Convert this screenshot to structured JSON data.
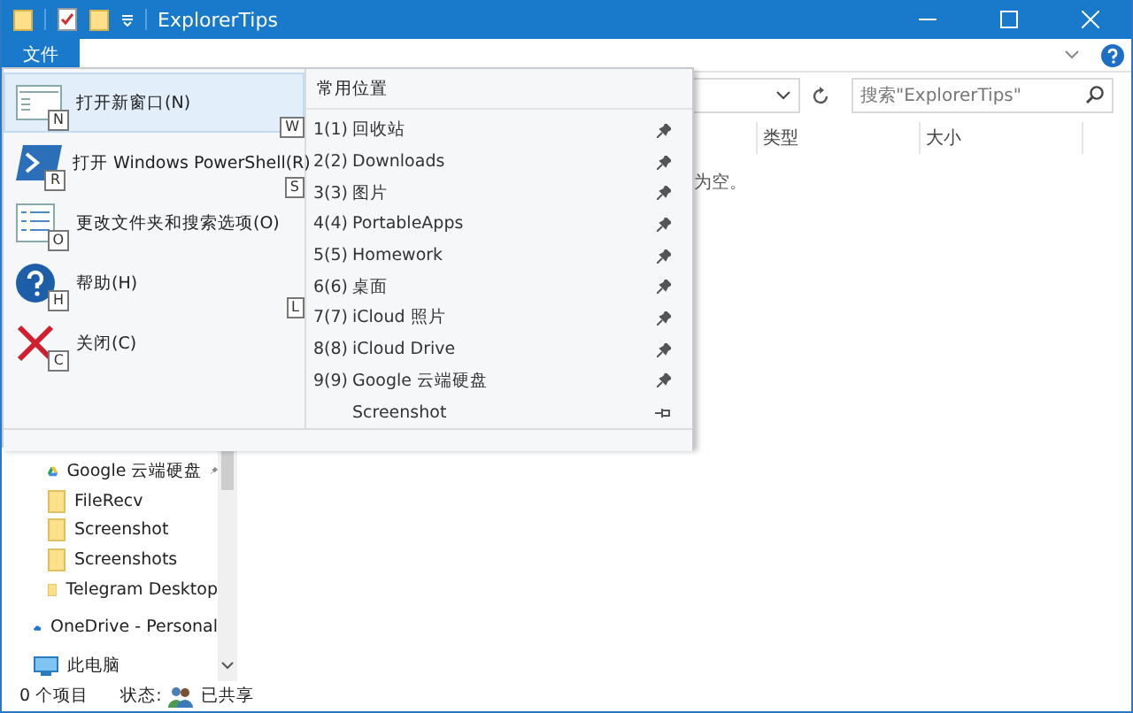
{
  "window": {
    "title": "ExplorerTips"
  },
  "ribbon": {
    "file_tab": "文件"
  },
  "search": {
    "placeholder": "搜索\"ExplorerTips\""
  },
  "columns": [
    {
      "label": "类型"
    },
    {
      "label": "大小"
    }
  ],
  "empty_message": "为空。",
  "nav": [
    {
      "label": "Google 云端硬盘",
      "kind": "drive",
      "pinned": true
    },
    {
      "label": "FileRecv",
      "kind": "folder",
      "pinned": false
    },
    {
      "label": "Screenshot",
      "kind": "folder",
      "pinned": false
    },
    {
      "label": "Screenshots",
      "kind": "folder",
      "pinned": false
    },
    {
      "label": "Telegram Desktop",
      "kind": "folder",
      "pinned": false
    },
    {
      "label": "OneDrive - Personal",
      "kind": "cloud",
      "pinned": false
    },
    {
      "label": "此电脑",
      "kind": "pc",
      "pinned": false
    }
  ],
  "status_bar": {
    "count": "0 个项目",
    "state_label": "状态:",
    "state": "已共享"
  },
  "file_menu": {
    "commands": [
      {
        "label": "打开新窗口(N)",
        "key": "N",
        "side_key": "W",
        "kind": "window",
        "selected": true
      },
      {
        "label": "打开 Windows PowerShell(R)",
        "key": "R",
        "side_key": "S",
        "kind": "shell",
        "selected": false
      },
      {
        "label": "更改文件夹和搜索选项(O)",
        "key": "O",
        "kind": "options",
        "selected": false
      },
      {
        "label": "帮助(H)",
        "key": "H",
        "side_key": "L",
        "kind": "help",
        "selected": false
      },
      {
        "label": "关闭(C)",
        "key": "C",
        "kind": "close",
        "selected": false
      }
    ],
    "recent_title": "常用位置",
    "recent": [
      {
        "number": "1(1)",
        "name": "回收站",
        "pinned": true
      },
      {
        "number": "2(2)",
        "name": "Downloads",
        "pinned": true
      },
      {
        "number": "3(3)",
        "name": "图片",
        "pinned": true
      },
      {
        "number": "4(4)",
        "name": "PortableApps",
        "pinned": true
      },
      {
        "number": "5(5)",
        "name": "Homework",
        "pinned": true
      },
      {
        "number": "6(6)",
        "name": "桌面",
        "pinned": true
      },
      {
        "number": "7(7)",
        "name": "iCloud 照片",
        "pinned": true
      },
      {
        "number": "8(8)",
        "name": "iCloud Drive",
        "pinned": true
      },
      {
        "number": "9(9)",
        "name": "Google 云端硬盘",
        "pinned": true
      },
      {
        "name": "Screenshot",
        "pinned": false
      }
    ]
  }
}
